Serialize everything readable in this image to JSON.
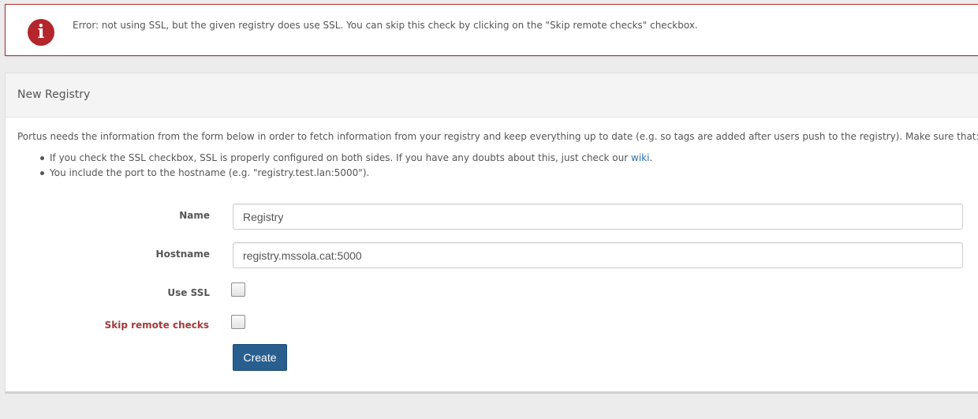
{
  "alert": {
    "icon": "info-icon",
    "icon_glyph": "i",
    "accent_color": "#b3262b",
    "message": "Error: not using SSL, but the given registry does use SSL. You can skip this check by clicking on the \"Skip remote checks\" checkbox."
  },
  "panel": {
    "title": "New Registry",
    "intro": "Portus needs the information from the form below in order to fetch information from your registry and keep everything up to date (e.g. so tags are added after users push to the registry). Make sure that:",
    "bullets": {
      "ssl_text": "If you check the SSL checkbox, SSL is properly configured on both sides. If you have any doubts about this, just check our ",
      "ssl_link": "wiki",
      "ssl_end": ".",
      "port_text": "You include the port to the hostname (e.g. \"registry.test.lan:5000\")."
    }
  },
  "form": {
    "name_label": "Name",
    "name_value": "Registry",
    "hostname_label": "Hostname",
    "hostname_value": "registry.mssola.cat:5000",
    "use_ssl_label": "Use SSL",
    "use_ssl_checked": false,
    "skip_label": "Skip remote checks",
    "skip_checked": false,
    "create_label": "Create",
    "create_color": "#285f8f"
  }
}
